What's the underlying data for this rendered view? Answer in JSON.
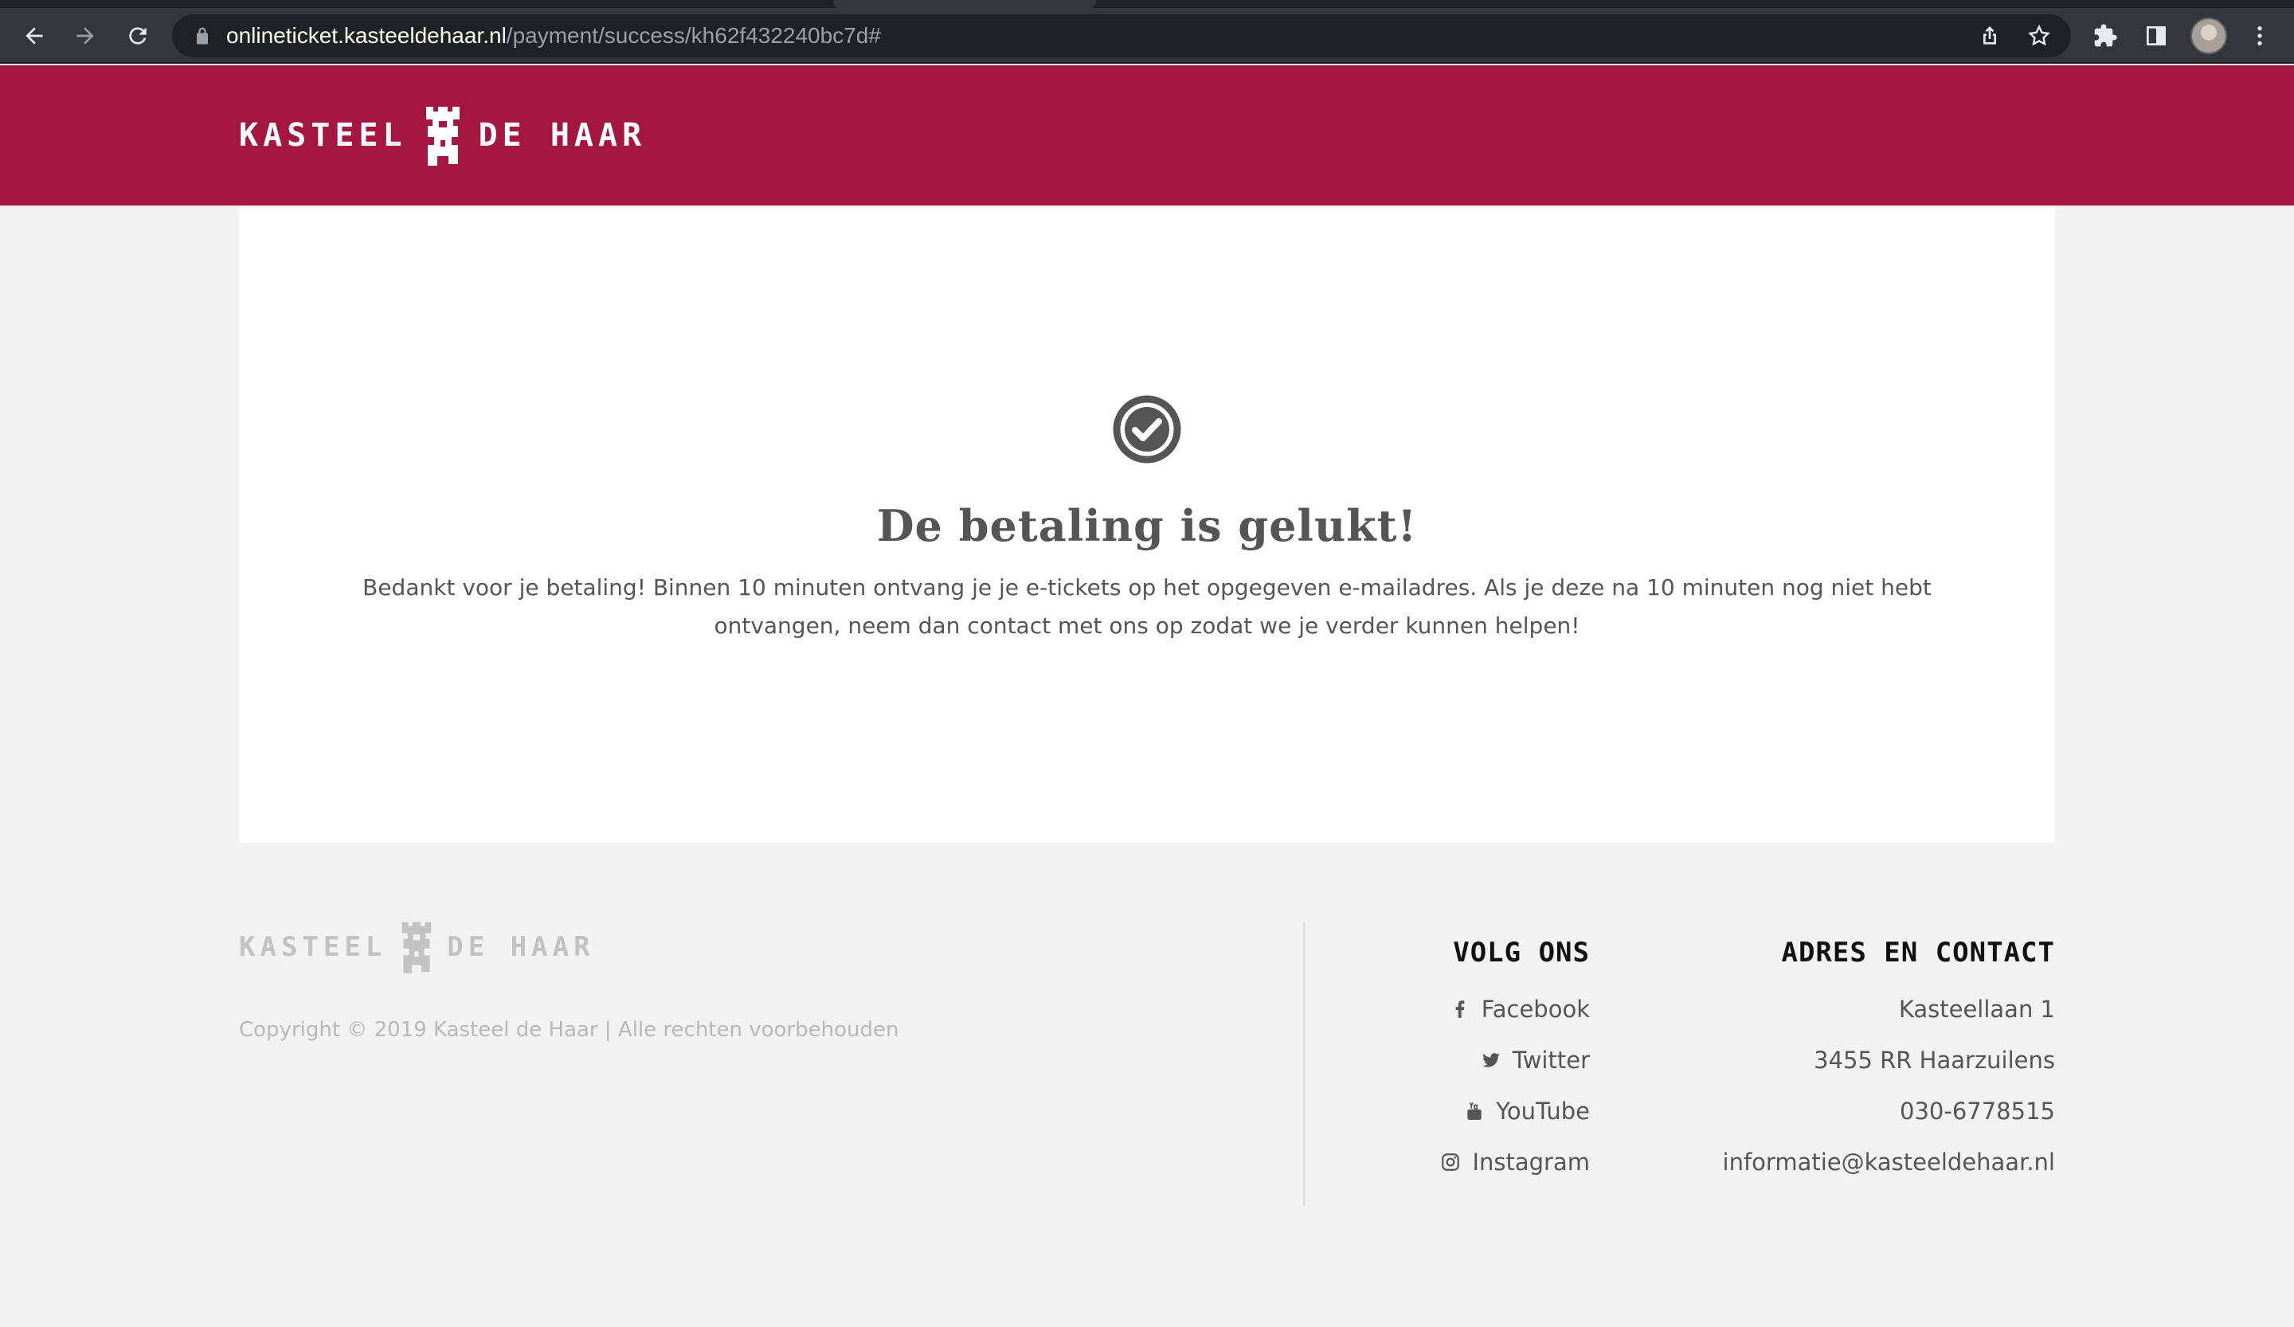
{
  "browser": {
    "url_host": "onlineticket.kasteeldehaar.nl",
    "url_path": "/payment/success/kh62f432240bc7d#"
  },
  "brand": {
    "name_left": "KASTEEL",
    "name_right": "DE HAAR",
    "header_color": "#a4153f"
  },
  "content": {
    "title": "De betaling is gelukt!",
    "message": "Bedankt voor je betaling! Binnen 10 minuten ontvang je je e-tickets op het opgegeven e-mailadres. Als je deze na 10 minuten nog niet hebt ontvangen, neem dan contact met ons op zodat we je verder kunnen helpen!",
    "icon": "check-circle-icon"
  },
  "footer": {
    "copyright": "Copyright © 2019 Kasteel de Haar | Alle rechten voorbehouden",
    "social": {
      "title": "VOLG ONS",
      "items": [
        {
          "label": "Facebook",
          "icon": "facebook-icon"
        },
        {
          "label": "Twitter",
          "icon": "twitter-icon"
        },
        {
          "label": "YouTube",
          "icon": "youtube-icon"
        },
        {
          "label": "Instagram",
          "icon": "instagram-icon"
        }
      ]
    },
    "contact": {
      "title": "ADRES EN CONTACT",
      "address": "Kasteellaan 1",
      "city": "3455 RR Haarzuilens",
      "phone": "030-6778515",
      "email": "informatie@kasteeldehaar.nl"
    }
  }
}
